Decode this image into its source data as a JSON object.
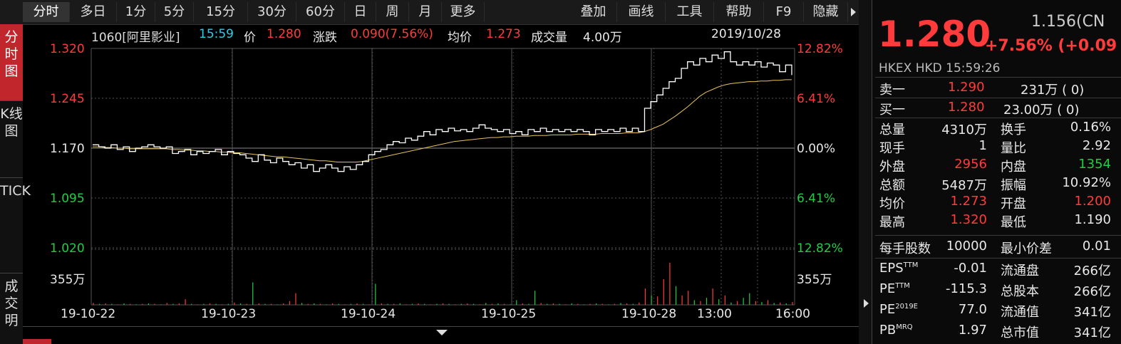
{
  "toolbar": {
    "left_tabs": [
      "分时",
      "多日",
      "1分",
      "5分",
      "15分",
      "30分",
      "60分",
      "日",
      "周",
      "月",
      "更多"
    ],
    "right_tabs": [
      "叠加",
      "画线",
      "工具",
      "帮助",
      "F9",
      "隐藏"
    ]
  },
  "side_tabs": [
    "分时图",
    "K线图",
    "TICK",
    "成交明"
  ],
  "info": {
    "code_name": "1060[阿里影业]",
    "time": "15:59",
    "price_label": "价",
    "price": "1.280",
    "change_label": "涨跌",
    "change": "0.090(7.56%)",
    "avg_label": "均价",
    "avg": "1.273",
    "volume_label": "成交量",
    "volume": "4.00万",
    "date": "2019/10/28"
  },
  "colors": {
    "up": "#ff3b3b",
    "down": "#22cc44",
    "price_line": "#ffffff",
    "avg_line": "#e8c35a",
    "grid": "#555555"
  },
  "chart_data": {
    "type": "line",
    "title": "",
    "base_price": 1.17,
    "ylim": [
      1.02,
      1.32
    ],
    "y_ticks_left": [
      "1.320",
      "1.245",
      "1.170",
      "1.095",
      "1.020"
    ],
    "y_ticks_right": [
      "12.82%",
      "6.41%",
      "0.00%",
      "6.41%",
      "12.82%"
    ],
    "x_labels": [
      "19-10-22",
      "19-10-23",
      "19-10-24",
      "19-10-25",
      "19-10-28",
      "13:00",
      "16:00"
    ],
    "volume_max_label": "355万",
    "series": [
      {
        "values": [
          1.175,
          1.172,
          1.17,
          1.175,
          1.168,
          1.172,
          1.165,
          1.17,
          1.172,
          1.175,
          1.172,
          1.17,
          1.172,
          1.162,
          1.165,
          1.168,
          1.16,
          1.165,
          1.162,
          1.165,
          1.168,
          1.16,
          1.165,
          1.162,
          1.16,
          1.155,
          1.15,
          1.16,
          1.152,
          1.148,
          1.155,
          1.15,
          1.145,
          1.148,
          1.14,
          1.145,
          1.135,
          1.14,
          1.145,
          1.14,
          1.135,
          1.142,
          1.138,
          1.145,
          1.15,
          1.16,
          1.165,
          1.168,
          1.175,
          1.18,
          1.178,
          1.185,
          1.182,
          1.188,
          1.195,
          1.19,
          1.198,
          1.195,
          1.2,
          1.196,
          1.198,
          1.195,
          1.2,
          1.205,
          1.2,
          1.198,
          1.195,
          1.198,
          1.192,
          1.195,
          1.19,
          1.198,
          1.195,
          1.2,
          1.195,
          1.198,
          1.195,
          1.198,
          1.195,
          1.198,
          1.195,
          1.19,
          1.198,
          1.195,
          1.198,
          1.195,
          1.2,
          1.195,
          1.2,
          1.195,
          1.23,
          1.24,
          1.25,
          1.26,
          1.27,
          1.275,
          1.29,
          1.3,
          1.295,
          1.305,
          1.3,
          1.31,
          1.305,
          1.315,
          1.3,
          1.295,
          1.3,
          1.295,
          1.3,
          1.292,
          1.298,
          1.295,
          1.285,
          1.295,
          1.28
        ]
      },
      {
        "values": [
          1.172,
          1.172,
          1.171,
          1.171,
          1.17,
          1.17,
          1.169,
          1.169,
          1.169,
          1.169,
          1.169,
          1.169,
          1.169,
          1.168,
          1.168,
          1.167,
          1.167,
          1.166,
          1.166,
          1.165,
          1.165,
          1.164,
          1.164,
          1.163,
          1.163,
          1.162,
          1.161,
          1.16,
          1.159,
          1.158,
          1.157,
          1.157,
          1.156,
          1.155,
          1.154,
          1.153,
          1.152,
          1.151,
          1.151,
          1.15,
          1.149,
          1.149,
          1.149,
          1.149,
          1.15,
          1.152,
          1.154,
          1.156,
          1.158,
          1.16,
          1.162,
          1.164,
          1.166,
          1.168,
          1.17,
          1.172,
          1.174,
          1.176,
          1.178,
          1.18,
          1.181,
          1.182,
          1.183,
          1.184,
          1.185,
          1.186,
          1.186,
          1.187,
          1.187,
          1.188,
          1.188,
          1.188,
          1.189,
          1.189,
          1.189,
          1.19,
          1.19,
          1.19,
          1.19,
          1.191,
          1.191,
          1.191,
          1.191,
          1.192,
          1.192,
          1.192,
          1.192,
          1.193,
          1.193,
          1.193,
          1.195,
          1.198,
          1.202,
          1.206,
          1.212,
          1.218,
          1.225,
          1.232,
          1.24,
          1.248,
          1.254,
          1.258,
          1.262,
          1.265,
          1.267,
          1.268,
          1.269,
          1.27,
          1.27,
          1.271,
          1.271,
          1.272,
          1.272,
          1.273,
          1.273
        ]
      }
    ],
    "volume": [
      4,
      2,
      3,
      2,
      1,
      3,
      2,
      1,
      2,
      3,
      2,
      1,
      4,
      2,
      3,
      12,
      2,
      1,
      2,
      3,
      2,
      1,
      2,
      5,
      3,
      2,
      48,
      3,
      2,
      2,
      1,
      3,
      8,
      25,
      4,
      2,
      3,
      2,
      1,
      3,
      2,
      1,
      2,
      3,
      2,
      1,
      45,
      3,
      2,
      2,
      3,
      1,
      2,
      3,
      2,
      1,
      2,
      3,
      2,
      1,
      2,
      3,
      2,
      1,
      4,
      2,
      3,
      2,
      1,
      10,
      3,
      2,
      30,
      4,
      2,
      3,
      2,
      1,
      3,
      2,
      1,
      2,
      3,
      2,
      1,
      2,
      4,
      3,
      2,
      5,
      35,
      20,
      18,
      55,
      90,
      40,
      20,
      30,
      10,
      8,
      15,
      35,
      12,
      20,
      5,
      8,
      15,
      25,
      8,
      6,
      10,
      4,
      5,
      3,
      6
    ],
    "volume_up": [
      1,
      0,
      1,
      0,
      1,
      0,
      1,
      0,
      1,
      0,
      1,
      0,
      1,
      0,
      1,
      1,
      0,
      1,
      0,
      1,
      0,
      1,
      0,
      1,
      0,
      1,
      0,
      1,
      0,
      1,
      0,
      1,
      1,
      1,
      0,
      1,
      0,
      1,
      0,
      1,
      0,
      1,
      0,
      1,
      0,
      1,
      0,
      1,
      0,
      1,
      0,
      1,
      0,
      1,
      0,
      1,
      0,
      1,
      0,
      1,
      0,
      1,
      0,
      1,
      0,
      1,
      0,
      1,
      0,
      0,
      1,
      0,
      0,
      1,
      0,
      1,
      0,
      1,
      0,
      1,
      0,
      1,
      0,
      1,
      0,
      1,
      0,
      1,
      0,
      1,
      1,
      0,
      1,
      1,
      1,
      0,
      1,
      1,
      0,
      1,
      0,
      1,
      0,
      1,
      0,
      1,
      0,
      0,
      1,
      0,
      1,
      0,
      1,
      0,
      1
    ]
  },
  "panel": {
    "price": "1.280",
    "ref": "1.156(CN",
    "change": "+7.56% (+0.09",
    "market": "HKEX  HKD  15:59:26",
    "sell1_label": "卖一",
    "sell1_price": "1.290",
    "sell1_vol": "231万 (     0)",
    "buy1_label": "买一",
    "buy1_price": "1.280",
    "buy1_vol": "23.00万 (     0)",
    "rows": [
      {
        "l1": "总量",
        "v1": "4310万",
        "l2": "换手",
        "v2": "0.16%",
        "c1": "white",
        "c2": "white"
      },
      {
        "l1": "现手",
        "v1": "1",
        "l2": "量比",
        "v2": "2.92",
        "c1": "white",
        "c2": "white"
      },
      {
        "l1": "外盘",
        "v1": "2956",
        "l2": "内盘",
        "v2": "1354",
        "c1": "red",
        "c2": "green"
      },
      {
        "l1": "总额",
        "v1": "5487万",
        "l2": "振幅",
        "v2": "10.92%",
        "c1": "white",
        "c2": "white"
      },
      {
        "l1": "均价",
        "v1": "1.273",
        "l2": "开盘",
        "v2": "1.200",
        "c1": "red",
        "c2": "red"
      },
      {
        "l1": "最高",
        "v1": "1.320",
        "l2": "最低",
        "v2": "1.190",
        "c1": "red",
        "c2": "white"
      }
    ],
    "lot_label": "每手股数",
    "lot": "10000",
    "tick_label": "最小价差",
    "tick": "0.01",
    "fund": [
      {
        "l1": "EPS",
        "s1": "TTM",
        "v1": "-0.01",
        "l2": "流通盘",
        "v2": "266亿"
      },
      {
        "l1": "PE",
        "s1": "TTM",
        "v1": "-115.3",
        "l2": "总股本",
        "v2": "266亿"
      },
      {
        "l1": "PE",
        "s1": "2019E",
        "v1": "77.0",
        "l2": "流通值",
        "v2": "341亿"
      },
      {
        "l1": "PB",
        "s1": "MRQ",
        "v1": "1.97",
        "l2": "总市值",
        "v2": "341亿"
      }
    ]
  }
}
